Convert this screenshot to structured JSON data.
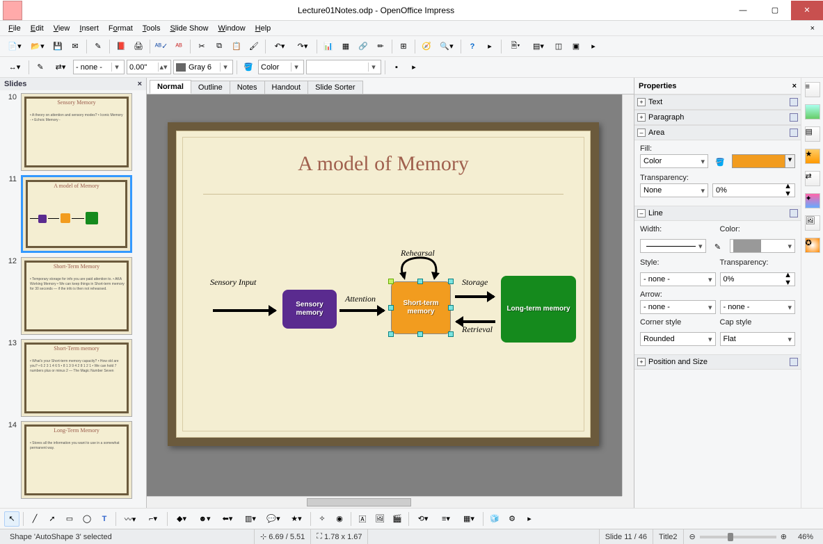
{
  "window": {
    "title": "Lecture01Notes.odp - OpenOffice Impress"
  },
  "menu": [
    "File",
    "Edit",
    "View",
    "Insert",
    "Format",
    "Tools",
    "Slide Show",
    "Window",
    "Help"
  ],
  "toolbar2": {
    "style": "- none -",
    "width": "0.00\"",
    "color_name": "Gray 6",
    "fill_mode": "Color"
  },
  "slides_panel": {
    "title": "Slides",
    "items": [
      {
        "num": "10",
        "title": "Sensory Memory",
        "body": "• A theory on attention and sensory modes?\n• Iconic Memory -\n• Echoic Memory -"
      },
      {
        "num": "11",
        "title": "A model of Memory",
        "body": ""
      },
      {
        "num": "12",
        "title": "Short-Term Memory",
        "body": "• Temporary storage for info you are paid attention to.\n• AKA Working Memory\n• We can keep things in Short-term memory for 30 seconds — if the info is then not rehearsed."
      },
      {
        "num": "13",
        "title": "Short-Term memory",
        "body": "• What's your Short-term memory capacity?\n• How old are you?\n  • 6 2 3 1 4 6 5\n  • 8 1 3 9 4 2 8 1 2 1\n• We can hold 7 numbers plus or minus 2 — The Magic Number Seven"
      },
      {
        "num": "14",
        "title": "Long-Term Memory",
        "body": "• Stores all the information you want to use in a somewhat permanent way."
      }
    ],
    "active_index": 1
  },
  "view_tabs": [
    "Normal",
    "Outline",
    "Notes",
    "Handout",
    "Slide Sorter"
  ],
  "slide": {
    "title": "A model of Memory",
    "labels": {
      "sensory_input": "Sensory Input",
      "attention": "Attention",
      "rehearsal": "Rehearsal",
      "storage": "Storage",
      "retrieval": "Retrieval"
    },
    "boxes": {
      "sensory": "Sensory memory",
      "short": "Short-term memory",
      "long": "Long-term memory"
    }
  },
  "properties": {
    "title": "Properties",
    "sections": {
      "text": "Text",
      "paragraph": "Paragraph",
      "area": "Area",
      "line": "Line",
      "pos": "Position and Size"
    },
    "area": {
      "fill_label": "Fill:",
      "fill_mode": "Color",
      "transparency_label": "Transparency:",
      "transparency_mode": "None",
      "transparency_value": "0%"
    },
    "line": {
      "width_label": "Width:",
      "color_label": "Color:",
      "style_label": "Style:",
      "style": "- none -",
      "transparency_label": "Transparency:",
      "transparency": "0%",
      "arrow_label": "Arrow:",
      "arrow_start": "- none -",
      "arrow_end": "- none -",
      "corner_label": "Corner style",
      "corner": "Rounded",
      "cap_label": "Cap style",
      "cap": "Flat"
    }
  },
  "status": {
    "selection": "Shape 'AutoShape 3' selected",
    "pos": "6.69 / 5.51",
    "size": "1.78 x 1.67",
    "slide": "Slide 11 / 46",
    "master": "Title2",
    "zoom": "46%"
  }
}
